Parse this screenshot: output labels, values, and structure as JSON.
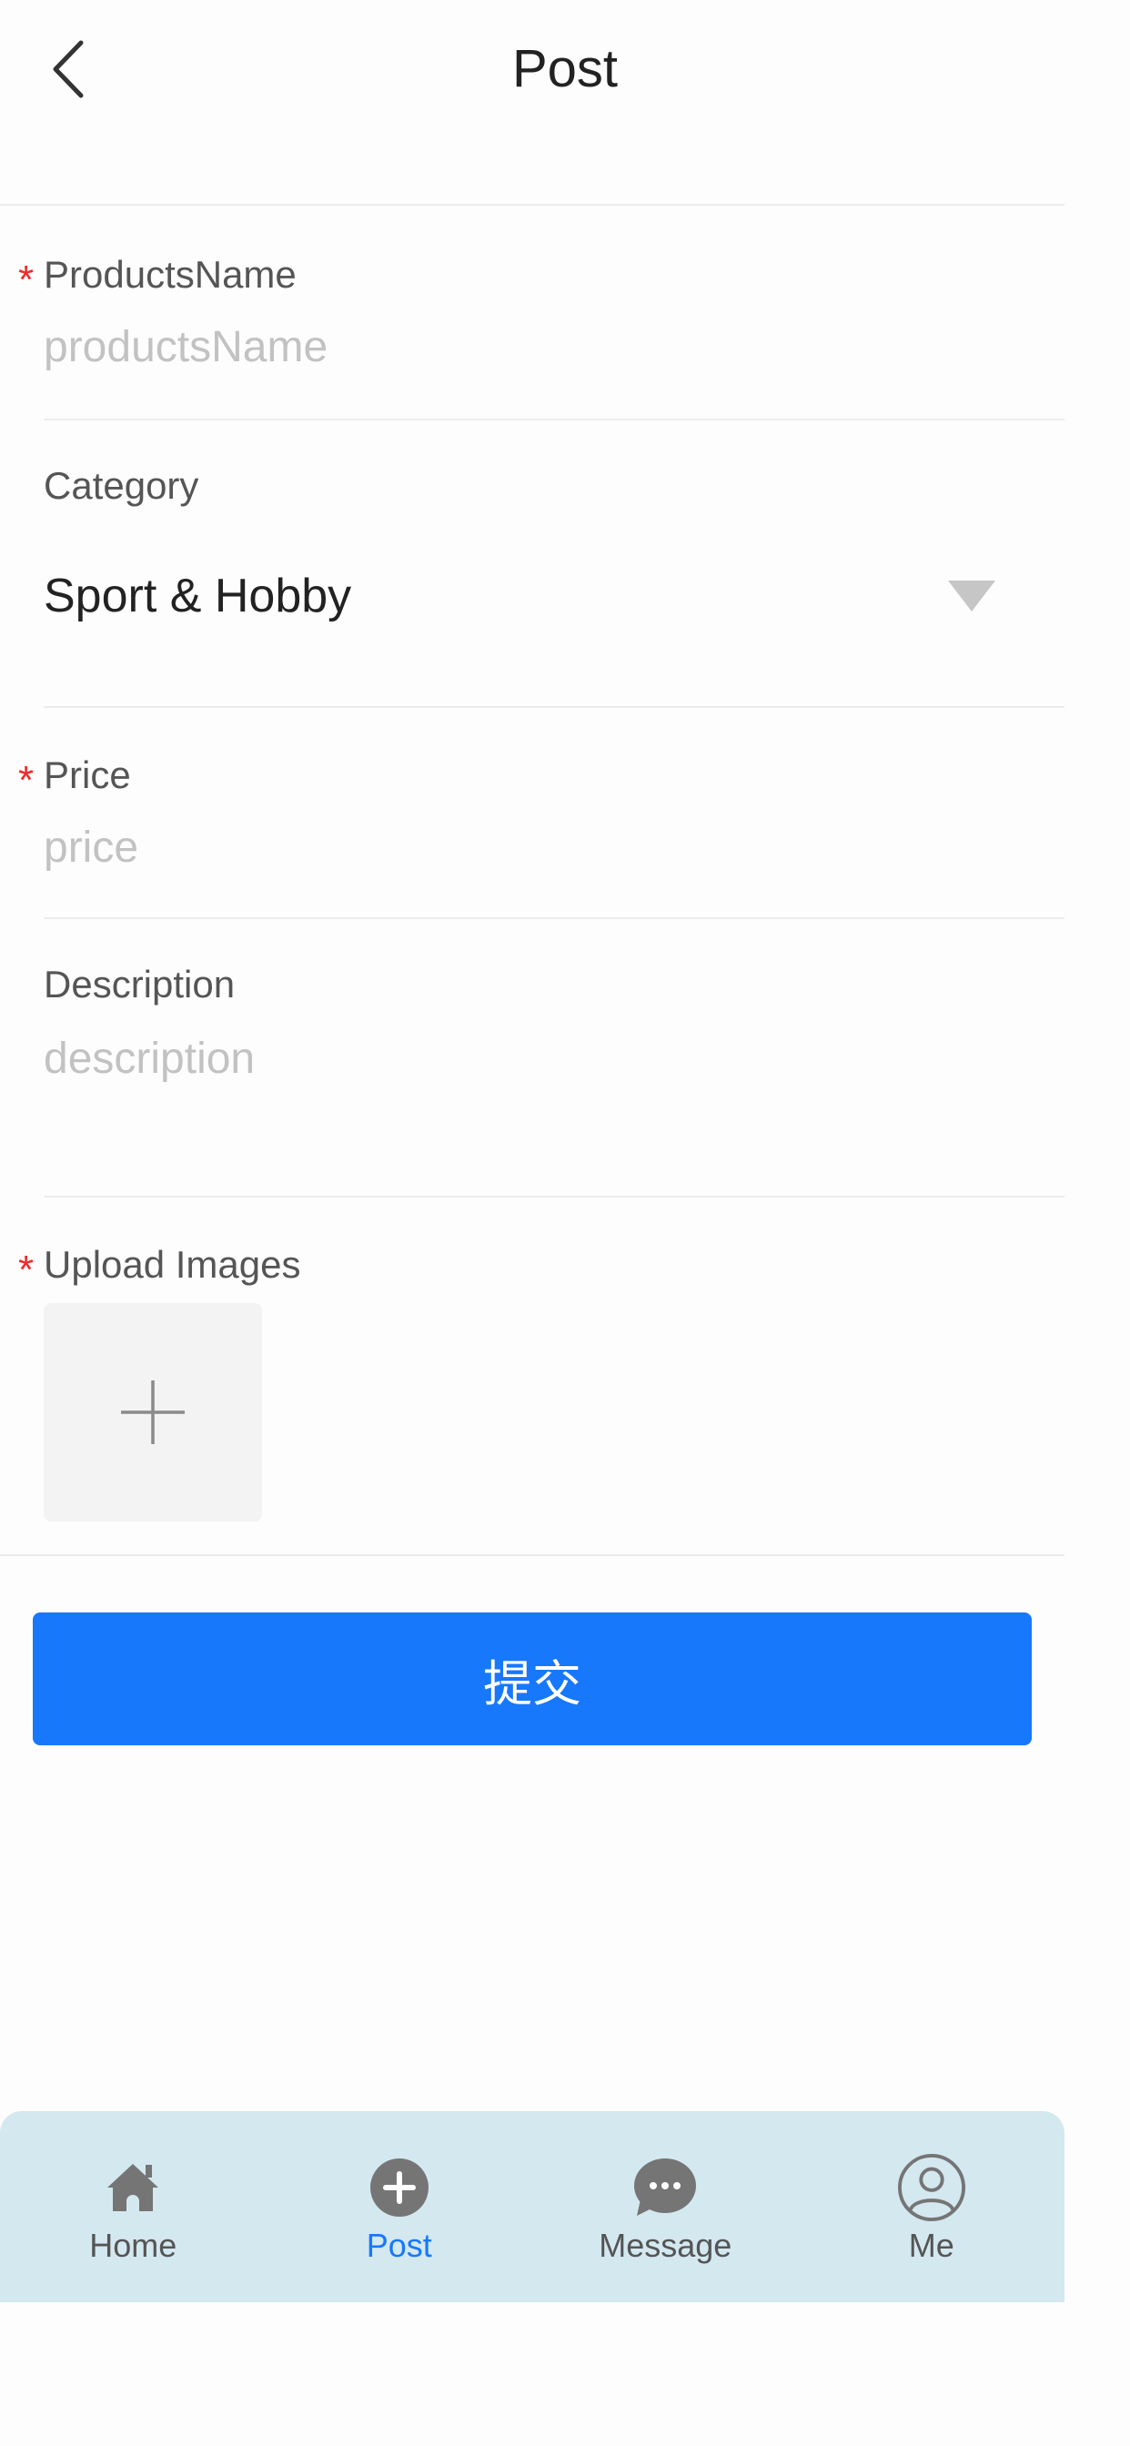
{
  "header": {
    "title": "Post",
    "back_icon": "chevron-left-icon"
  },
  "form": {
    "products_name": {
      "label": "ProductsName",
      "required": true,
      "placeholder": "productsName",
      "value": ""
    },
    "category": {
      "label": "Category",
      "selected": "Sport & Hobby",
      "caret_icon": "caret-down-icon"
    },
    "price": {
      "label": "Price",
      "required": true,
      "placeholder": "price",
      "value": ""
    },
    "description": {
      "label": "Description",
      "placeholder": "description",
      "value": ""
    },
    "upload": {
      "label": "Upload Images",
      "required": true,
      "add_icon": "plus-icon"
    },
    "required_mark": "*"
  },
  "submit": {
    "label": "提交"
  },
  "tabbar": {
    "active": "Post",
    "items": [
      {
        "label": "Home",
        "icon": "home-icon"
      },
      {
        "label": "Post",
        "icon": "add-circle-icon"
      },
      {
        "label": "Message",
        "icon": "chat-bubble-icon"
      },
      {
        "label": "Me",
        "icon": "user-circle-icon"
      }
    ]
  },
  "colors": {
    "primary": "#1778fc",
    "required": "#f02a2a",
    "tabbar_bg": "#d4e8f0",
    "icon_gray": "#757575"
  }
}
